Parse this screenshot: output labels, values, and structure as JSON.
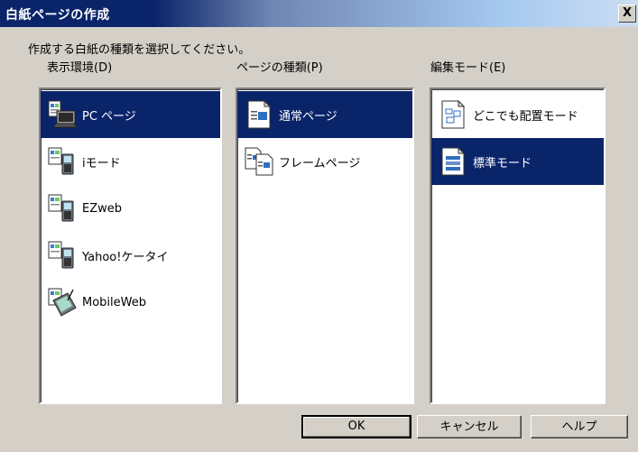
{
  "window": {
    "title": "白紙ページの作成",
    "close_glyph": "X"
  },
  "instruction": "作成する白紙の種類を選択してください。",
  "columns": {
    "display_env": {
      "label": "表示環境(D)",
      "items": [
        {
          "label": "PC ページ",
          "icon": "pc-monitor-icon",
          "selected": true
        },
        {
          "label": "iモード",
          "icon": "imode-phone-icon",
          "selected": false
        },
        {
          "label": "EZweb",
          "icon": "ezweb-phone-icon",
          "selected": false
        },
        {
          "label": "Yahoo!ケータイ",
          "icon": "yahoo-phone-icon",
          "selected": false
        },
        {
          "label": "MobileWeb",
          "icon": "pda-icon",
          "selected": false
        }
      ]
    },
    "page_type": {
      "label": "ページの種類(P)",
      "items": [
        {
          "label": "通常ページ",
          "icon": "normal-page-icon",
          "selected": true
        },
        {
          "label": "フレームページ",
          "icon": "frame-page-icon",
          "selected": false
        }
      ]
    },
    "edit_mode": {
      "label": "編集モード(E)",
      "items": [
        {
          "label": "どこでも配置モード",
          "icon": "free-layout-icon",
          "selected": false
        },
        {
          "label": "標準モード",
          "icon": "standard-mode-icon",
          "selected": true
        }
      ]
    }
  },
  "buttons": {
    "ok": "OK",
    "cancel": "キャンセル",
    "help": "ヘルプ"
  },
  "colors": {
    "selection": "#0a246a",
    "face": "#d4d0c8",
    "title_start": "#0a246a"
  }
}
